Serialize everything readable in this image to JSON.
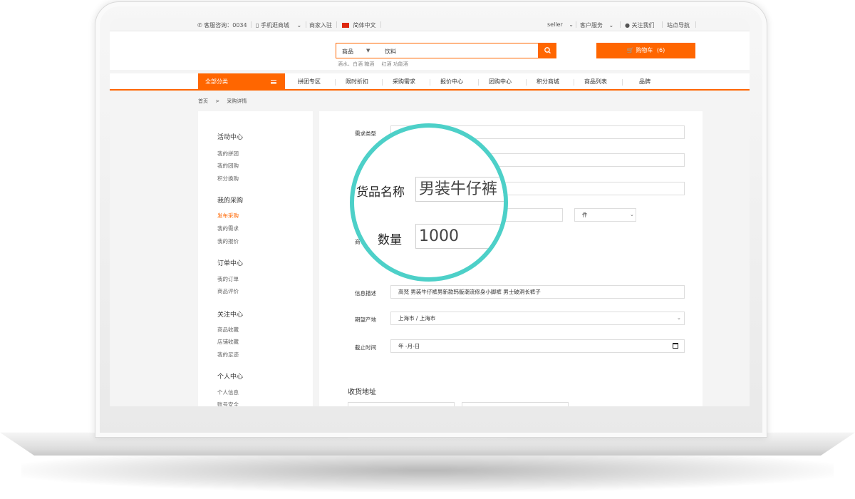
{
  "topbar": {
    "hotline": "客服咨询：0034",
    "mobile": "手机逛商城",
    "merchant": "商家入驻",
    "language": "简体中文",
    "user": "seller",
    "service": "客户服务",
    "follow": "关注我们",
    "sitemap": "站点导航"
  },
  "search": {
    "category": "商品",
    "query": "饮料",
    "hotwords": [
      "酒水、白酒 糖酒",
      "红酒 功能酒"
    ]
  },
  "cart": {
    "label": "购物车",
    "count": "(6)"
  },
  "nav": {
    "all_label": "全部分类",
    "items": [
      "拼团专区",
      "限时折扣",
      "采购需求",
      "报价中心",
      "团购中心",
      "积分商城",
      "商品列表",
      "品牌"
    ]
  },
  "breadcrumb": {
    "home": "首页",
    "sep": ">",
    "current": "采购详情"
  },
  "sidebar": {
    "groups": [
      {
        "title": "活动中心",
        "items": [
          "我的拼团",
          "我的团购",
          "积分换购"
        ]
      },
      {
        "title": "我的采购",
        "items": [
          "发布采购",
          "我的需求",
          "我的报价"
        ]
      },
      {
        "title": "订单中心",
        "items": [
          "我的订单",
          "商品评价"
        ]
      },
      {
        "title": "关注中心",
        "items": [
          "商品收藏",
          "店铺收藏",
          "我的足迹"
        ]
      },
      {
        "title": "个人中心",
        "items": [
          "个人信息",
          "账号安全"
        ]
      }
    ],
    "active_item": "发布采购"
  },
  "form": {
    "demand_type_label": "需求类型",
    "qty_label_short": "商",
    "unit_value": "件",
    "info_label": "信息描述",
    "info_value": "高梵 男装牛仔裤男新款韩版潮流修身小脚裤 男士破洞长裤子",
    "origin_label": "期望产地",
    "origin_value": "上海市 / 上海市",
    "deadline_label": "截止时间",
    "deadline_value": "年 -月-日",
    "address_title": "收货地址"
  },
  "magnifier": {
    "name_label": "货品名称",
    "name_value": "男装牛仔裤",
    "qty_label": "数量",
    "qty_value": "1000"
  },
  "colors": {
    "accent": "#ff6600",
    "magnifier_ring": "#4dd0c8"
  }
}
